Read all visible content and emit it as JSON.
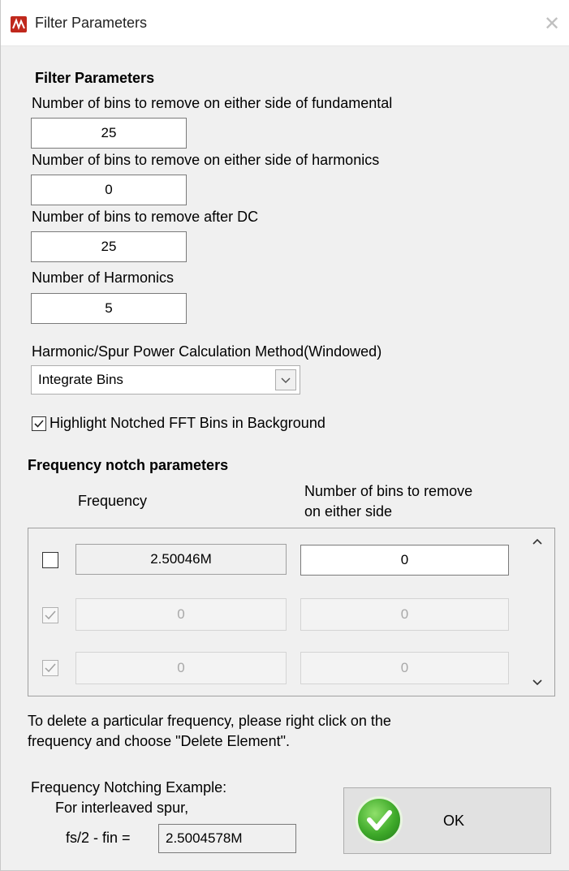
{
  "window": {
    "title": "Filter Parameters",
    "close_glyph": "✕"
  },
  "filter_params": {
    "heading": "Filter Parameters",
    "fundamental_label": "Number of bins to remove on either side of fundamental",
    "fundamental_value": "25",
    "harmonics_label": "Number of bins to remove on either side of harmonics",
    "harmonics_value": "0",
    "dc_label": "Number of bins to remove after DC",
    "dc_value": "25",
    "num_harmonics_label": "Number of Harmonics",
    "num_harmonics_value": "5",
    "method_label": "Harmonic/Spur Power Calculation Method(Windowed)",
    "method_value": "Integrate Bins",
    "highlight_label": "Highlight Notched FFT Bins in Background",
    "highlight_checked": true
  },
  "notch": {
    "heading": "Frequency notch parameters",
    "col_frequency": "Frequency",
    "col_bins_line1": "Number of bins to remove",
    "col_bins_line2": "on either side",
    "rows": [
      {
        "frequency": "2.50046M",
        "bins": "0",
        "checked": false,
        "enabled": true
      },
      {
        "frequency": "0",
        "bins": "0",
        "checked": true,
        "enabled": false
      },
      {
        "frequency": "0",
        "bins": "0",
        "checked": true,
        "enabled": false
      }
    ]
  },
  "help": {
    "line1": "To delete a particular frequency, please right click on the",
    "line2": "frequency and choose \"Delete Element\"."
  },
  "example": {
    "title": "Frequency Notching Example:",
    "subtitle": "For interleaved spur,",
    "formula_label": "fs/2 - fin =",
    "formula_value": "2.5004578M"
  },
  "ok_button": {
    "label": "OK"
  },
  "colors": {
    "app_icon": "#c0281c",
    "ok_green": "#3faa2a"
  }
}
